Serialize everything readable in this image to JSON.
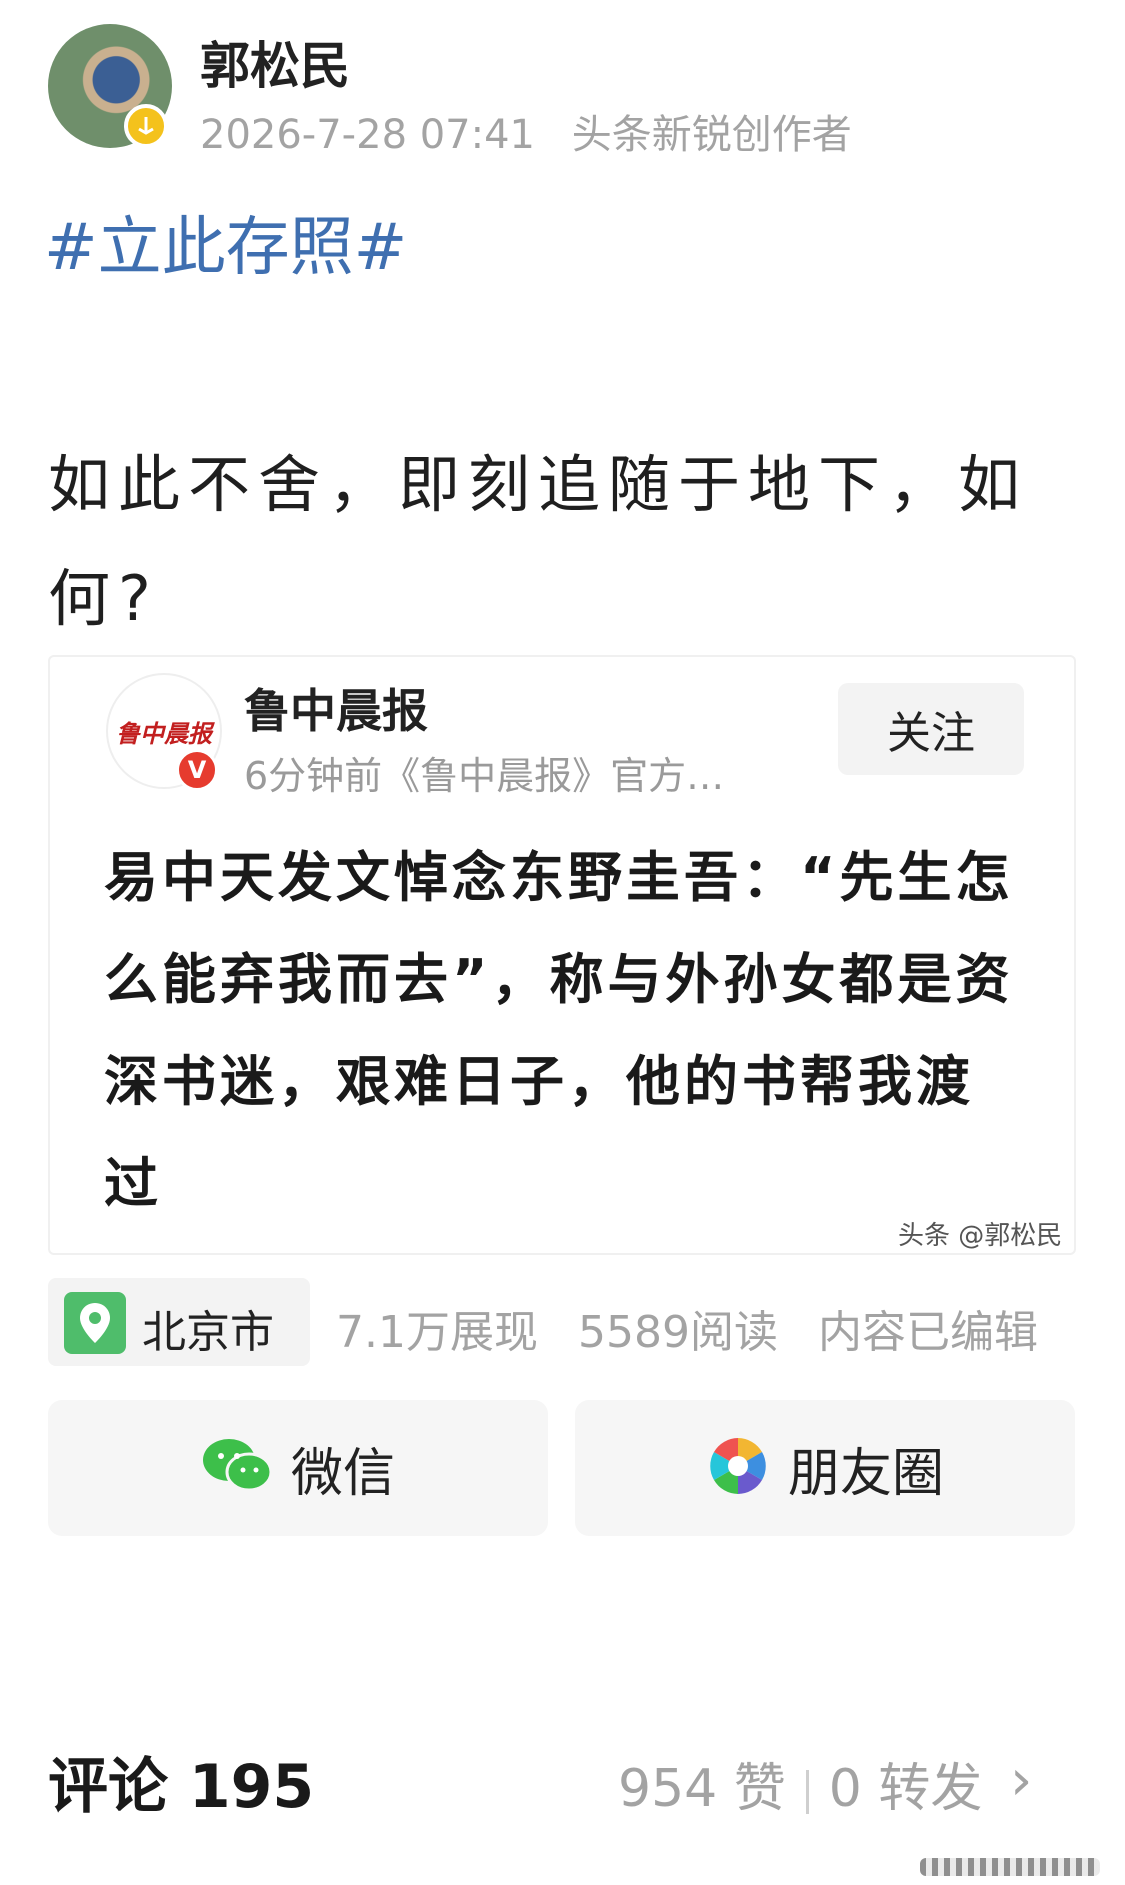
{
  "author": {
    "name": "郭松民",
    "timestamp": "2026-7-28 07:41",
    "badge": "头条新锐创作者"
  },
  "post": {
    "hashtag": "#立此存照#",
    "text": "如此不舍，即刻追随于地下，如何?"
  },
  "card": {
    "logo_text": "鲁中晨报",
    "verified_mark": "V",
    "name": "鲁中晨报",
    "meta": "6分钟前《鲁中晨报》官方…",
    "follow_label": "关注",
    "headline": "易中天发文悼念东野圭吾：“先生怎么能弃我而去”，称与外孙女都是资深书迷，艰难日子，他的书帮我渡过",
    "watermark": "头条 @郭松民"
  },
  "location": {
    "label": "北京市"
  },
  "stats": {
    "impressions": "7.1万展现",
    "reads": "5589阅读",
    "edited": "内容已编辑"
  },
  "share": {
    "wechat_label": "微信",
    "moments_label": "朋友圈"
  },
  "footer": {
    "comments": "评论 195",
    "likes": "954 赞",
    "reposts": "0 转发"
  },
  "colors": {
    "hashtag": "#3f6fb0",
    "muted": "#a3a3a3",
    "location_green": "#4fbd6b",
    "verified_red": "#e63b2e",
    "creator_badge": "#f4c21c"
  }
}
